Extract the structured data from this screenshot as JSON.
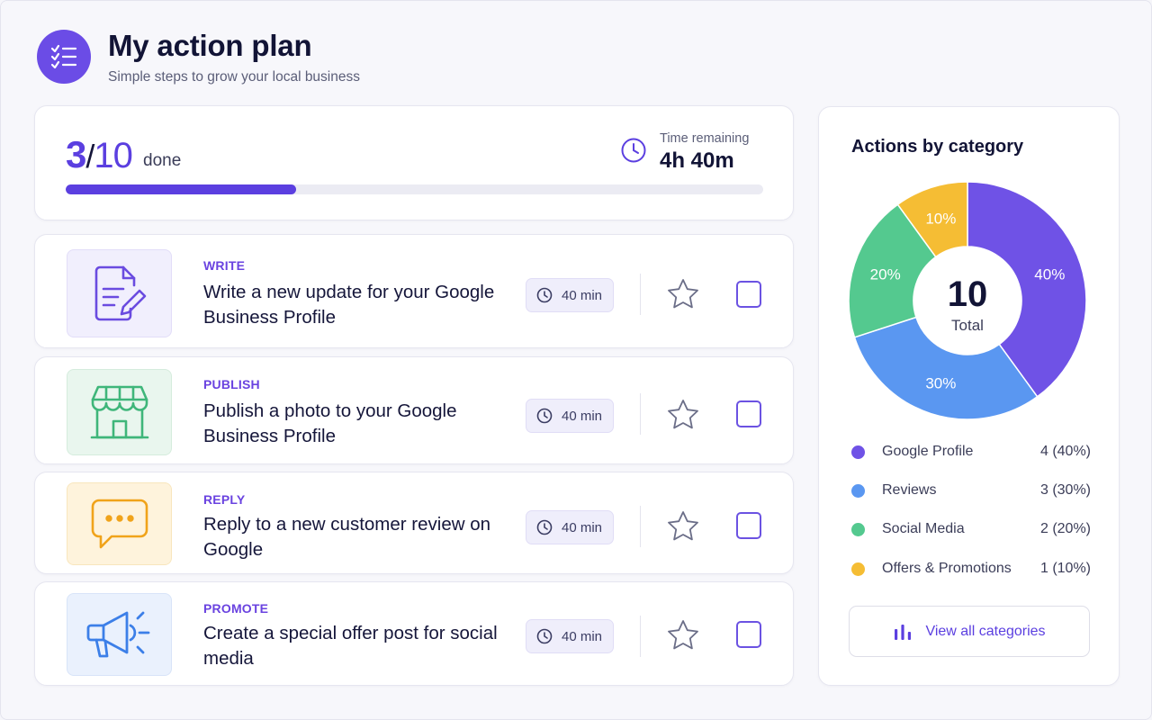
{
  "header": {
    "title": "My action plan",
    "subtitle": "Simple steps to grow your local business"
  },
  "progress": {
    "done": "3",
    "total": "10",
    "done_label": "done",
    "fraction_complete": 0.33,
    "time_remaining_label": "Time remaining",
    "time_remaining_value": "4h 40m"
  },
  "tasks": [
    {
      "category": "WRITE",
      "title": "Write a new update for your Google Business Profile",
      "duration": "40 min",
      "icon": "document-edit-icon",
      "starred": false,
      "checked": false
    },
    {
      "category": "PUBLISH",
      "title": "Publish a photo to your Google Business Profile",
      "duration": "40 min",
      "icon": "storefront-icon",
      "starred": false,
      "checked": false
    },
    {
      "category": "REPLY",
      "title": "Reply to a new customer review on Google",
      "duration": "40 min",
      "icon": "chat-bubble-icon",
      "starred": false,
      "checked": false
    },
    {
      "category": "PROMOTE",
      "title": "Create a special offer post for social media",
      "duration": "40 min",
      "icon": "megaphone-icon",
      "starred": false,
      "checked": false
    }
  ],
  "categories": {
    "title": "Actions by category",
    "center_value": "10",
    "center_label": "Total",
    "view_all_label": "View all categories",
    "items": [
      {
        "name": "Google Profile",
        "value": "4 (40%)",
        "percent_label": "40%",
        "color": "#6f52e6"
      },
      {
        "name": "Reviews",
        "value": "3 (30%)",
        "percent_label": "30%",
        "color": "#5a97f1"
      },
      {
        "name": "Social Media",
        "value": "2 (20%)",
        "percent_label": "20%",
        "color": "#54c98f"
      },
      {
        "name": "Offers & Promotions",
        "value": "1 (10%)",
        "percent_label": "10%",
        "color": "#f5bd34"
      }
    ]
  },
  "colors": {
    "accent": "#5b3fe0",
    "write_bg": "#f1effd",
    "publish_bg": "#e9f6ee",
    "reply_bg": "#fef3dc",
    "promote_bg": "#eaf1fd"
  }
}
